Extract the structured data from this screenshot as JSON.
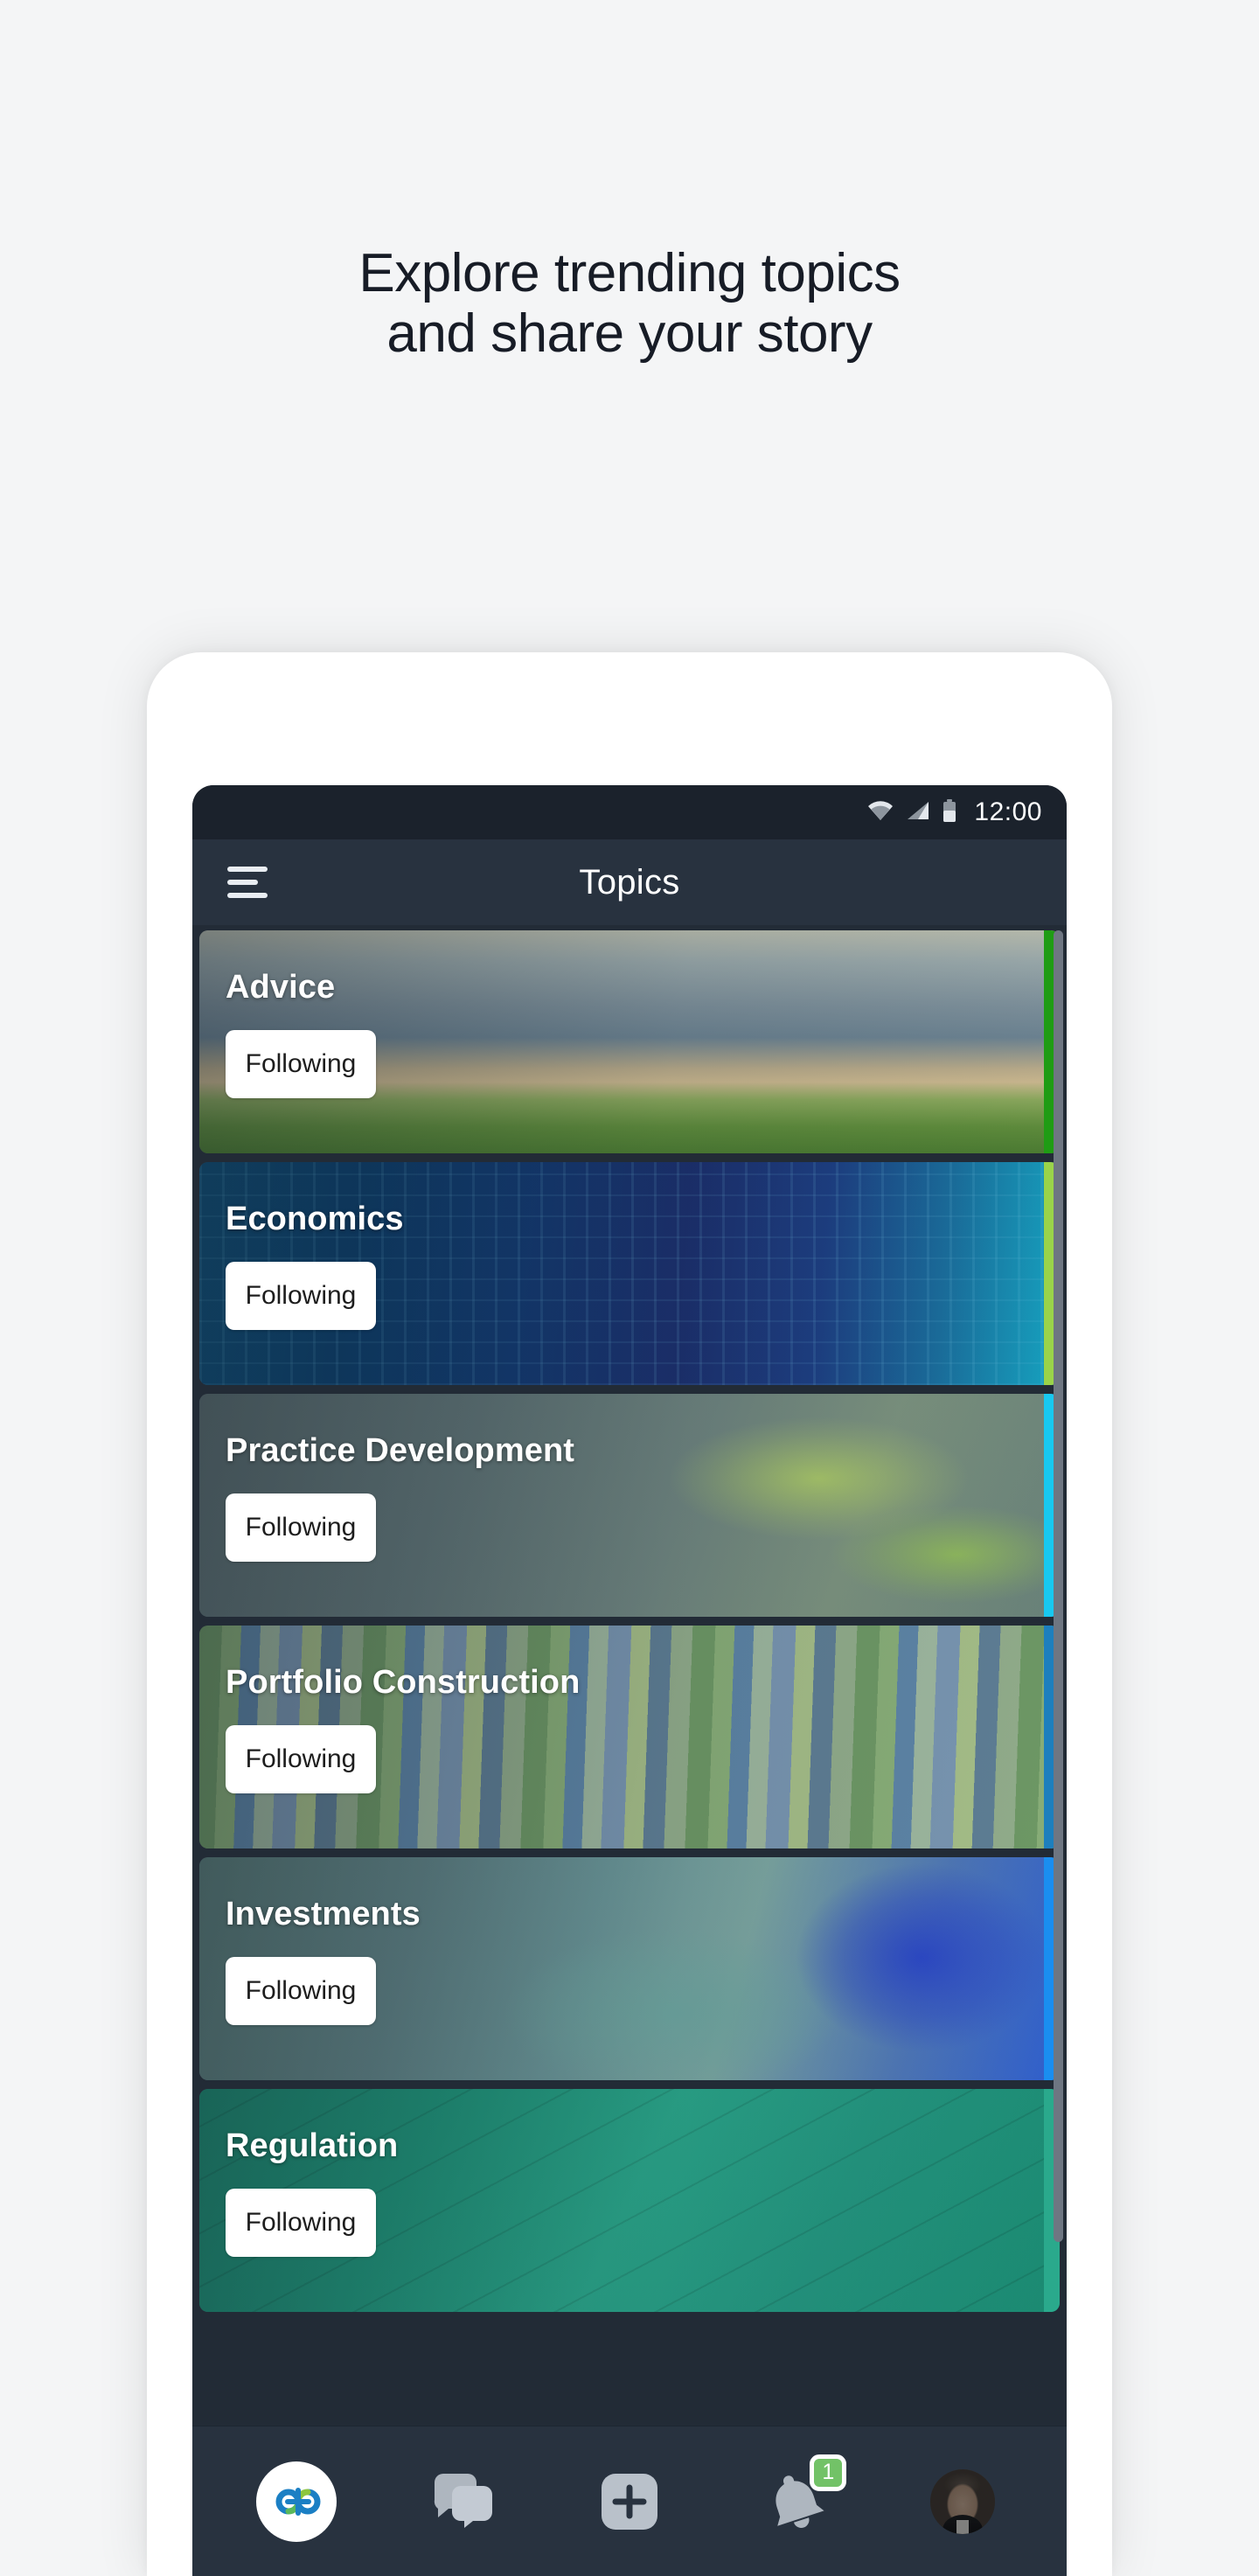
{
  "headline": "Explore trending topics\nand share your story",
  "phone": {
    "statusbar": {
      "time": "12:00",
      "icons": [
        "wifi-icon",
        "cellular-signal-icon",
        "battery-icon"
      ]
    },
    "appbar": {
      "menu_icon": "hamburger-menu-icon",
      "title": "Topics"
    },
    "topics": [
      {
        "title": "Advice",
        "follow_label": "Following",
        "accent": "#1f9c14"
      },
      {
        "title": "Economics",
        "follow_label": "Following",
        "accent": "#9ad34a"
      },
      {
        "title": "Practice Development",
        "follow_label": "Following",
        "accent": "#18c8f0"
      },
      {
        "title": "Portfolio Construction",
        "follow_label": "Following",
        "accent": "#1d7fbd"
      },
      {
        "title": "Investments",
        "follow_label": "Following",
        "accent": "#1a8ef0"
      },
      {
        "title": "Regulation",
        "follow_label": "Following",
        "accent": "#6e7682"
      }
    ],
    "bottomnav": [
      {
        "name": "home-logo",
        "icon": "app-logo-icon"
      },
      {
        "name": "messages",
        "icon": "chat-bubbles-icon"
      },
      {
        "name": "create-post",
        "icon": "plus-square-icon"
      },
      {
        "name": "notifications",
        "icon": "bell-icon",
        "badge": "1"
      },
      {
        "name": "profile",
        "icon": "avatar-icon"
      }
    ]
  },
  "colors": {
    "page_bg": "#f4f5f6",
    "headline_text": "#171c26",
    "statusbar_bg": "#1b222c",
    "appbar_bg": "#28323f",
    "screen_bg": "#222b36",
    "badge_green": "#72c267"
  }
}
